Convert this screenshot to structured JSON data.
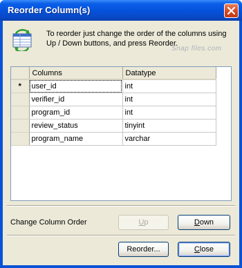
{
  "window": {
    "title": "Reorder Column(s)"
  },
  "info": {
    "icon": "reorder-columns-icon",
    "text": "To reorder just change the order of the columns using Up / Down buttons, and press Reorder.",
    "watermark": "Snap files.com"
  },
  "grid": {
    "headers": [
      "Columns",
      "Datatype"
    ],
    "current_row_marker": "*",
    "rows": [
      {
        "column": "user_id",
        "datatype": "int"
      },
      {
        "column": "verifier_id",
        "datatype": "int"
      },
      {
        "column": "program_id",
        "datatype": "int"
      },
      {
        "column": "review_status",
        "datatype": "tinyint"
      },
      {
        "column": "program_name",
        "datatype": "varchar"
      }
    ]
  },
  "order": {
    "label": "Change Column Order",
    "up": {
      "accel": "U",
      "rest": "p"
    },
    "down": {
      "accel": "D",
      "rest": "own"
    }
  },
  "footer": {
    "reorder_label": "Reorder...",
    "close": {
      "accel": "C",
      "rest": "lose"
    }
  },
  "colors": {
    "title_bar": "#0651d9",
    "dialog_bg": "#ece9d8",
    "close_button": "#d6461f"
  }
}
